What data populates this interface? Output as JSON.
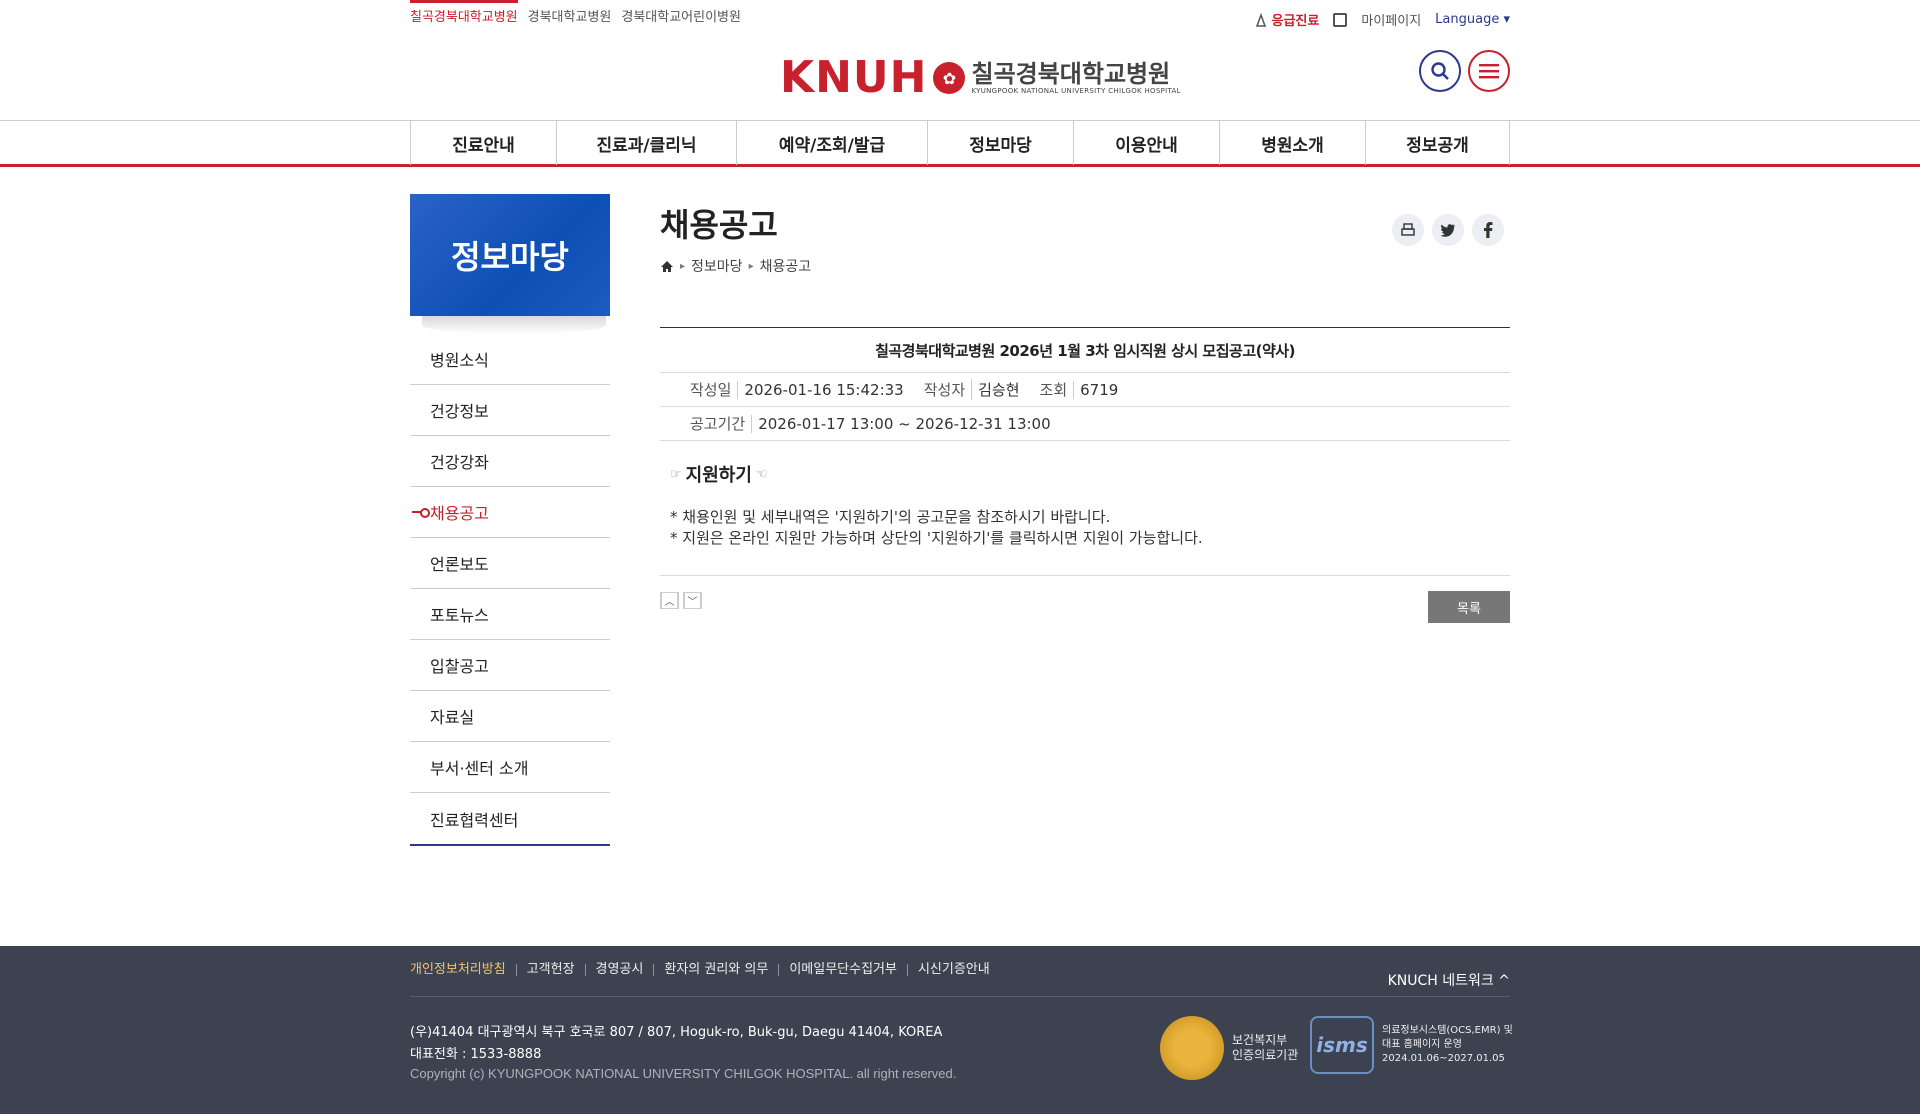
{
  "sites": [
    "칠곡경북대학교병원",
    "경북대학교병원",
    "경북대학교어린이병원"
  ],
  "util": {
    "emergency": "응급진료",
    "mypage": "마이페이지",
    "language": "Language ▾"
  },
  "logo": {
    "mark": "KNUH",
    "name_ko": "칠곡경북대학교병원",
    "name_en": "KYUNGPOOK NATIONAL UNIVERSITY CHILGOK HOSPITAL"
  },
  "gnb": [
    {
      "label": "진료안내",
      "w": 146
    },
    {
      "label": "진료과/클리닉",
      "w": 180
    },
    {
      "label": "예약/조회/발급",
      "w": 191
    },
    {
      "label": "정보마당",
      "w": 146
    },
    {
      "label": "이용안내",
      "w": 146
    },
    {
      "label": "병원소개",
      "w": 146
    },
    {
      "label": "정보공개",
      "w": 144
    }
  ],
  "lnb": {
    "title": "정보마당",
    "items": [
      "병원소식",
      "건강정보",
      "건강강좌",
      "채용공고",
      "언론보도",
      "포토뉴스",
      "입찰공고",
      "자료실",
      "부서·센터 소개",
      "진료협력센터"
    ],
    "active": "채용공고"
  },
  "content": {
    "title": "채용공고",
    "breadcrumb": [
      "정보마당",
      "채용공고"
    ],
    "post_title": "칠곡경북대학교병원 2026년 1월 3차 임시직원 상시 모집공고(약사)",
    "meta": {
      "date_label": "작성일",
      "date": "2026-01-16 15:42:33",
      "author_label": "작성자",
      "author": "김승현",
      "views_label": "조회",
      "views": "6719",
      "period_label": "공고기간",
      "period": "2026-01-17 13:00 ~ 2026-12-31 13:00"
    },
    "apply_title": "지원하기",
    "notices": [
      "* 채용인원 및 세부내역은 '지원하기'의 공고문을 참조하시기 바랍니다.",
      "* 지원은 온라인 지원만 가능하며 상단의 '지원하기'를 클릭하시면 지원이 가능합니다."
    ],
    "list_button": "목록"
  },
  "footer": {
    "links": [
      "개인정보처리방침",
      "고객헌장",
      "경영공시",
      "환자의 권리와 의무",
      "이메일무단수집거부",
      "시신기증안내"
    ],
    "network": "KNUCH 네트워크",
    "address": "(우)41404 대구광역시 북구 호국로 807 / 807, Hoguk-ro, Buk-gu, Daegu 41404, KOREA",
    "phone": "대표전화 : 1533-8888",
    "copyright": "Copyright (c) KYUNGPOOK NATIONAL UNIVERSITY CHILGOK HOSPITAL. all right reserved.",
    "badge1": {
      "l1": "보건복지부",
      "l2": "인증의료기관"
    },
    "badge2": {
      "l1": "의료정보시스템(OCS,EMR) 및",
      "l2": "대표 홈페이지 운영",
      "l3": "2024.01.06~2027.01.05"
    }
  }
}
